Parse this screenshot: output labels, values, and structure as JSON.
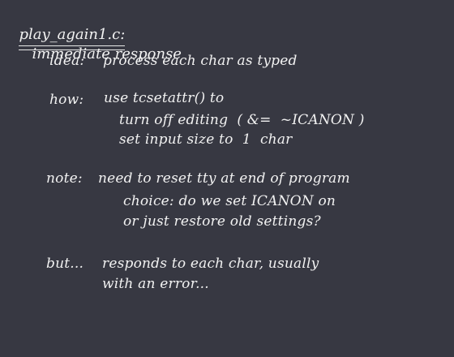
{
  "title": {
    "file": "play_again1.c:",
    "subtitle": "immediate response"
  },
  "idea": {
    "label": "idea:",
    "text": "process each char as typed"
  },
  "how": {
    "label": "how:",
    "line1": "use tcsetattr() to",
    "line2": "turn off editing  ( &=  ~ICANON )",
    "line3": "set input size to  1  char"
  },
  "note": {
    "label": "note:",
    "line1": "need to reset tty at end of program",
    "line2": "choice: do we set ICANON on",
    "line3": "or just restore old settings?"
  },
  "but": {
    "label": "but...",
    "line1": "responds to each char, usually",
    "line2": "with an error..."
  },
  "colors": {
    "background": "#373842",
    "text": "#f2f2f2"
  }
}
